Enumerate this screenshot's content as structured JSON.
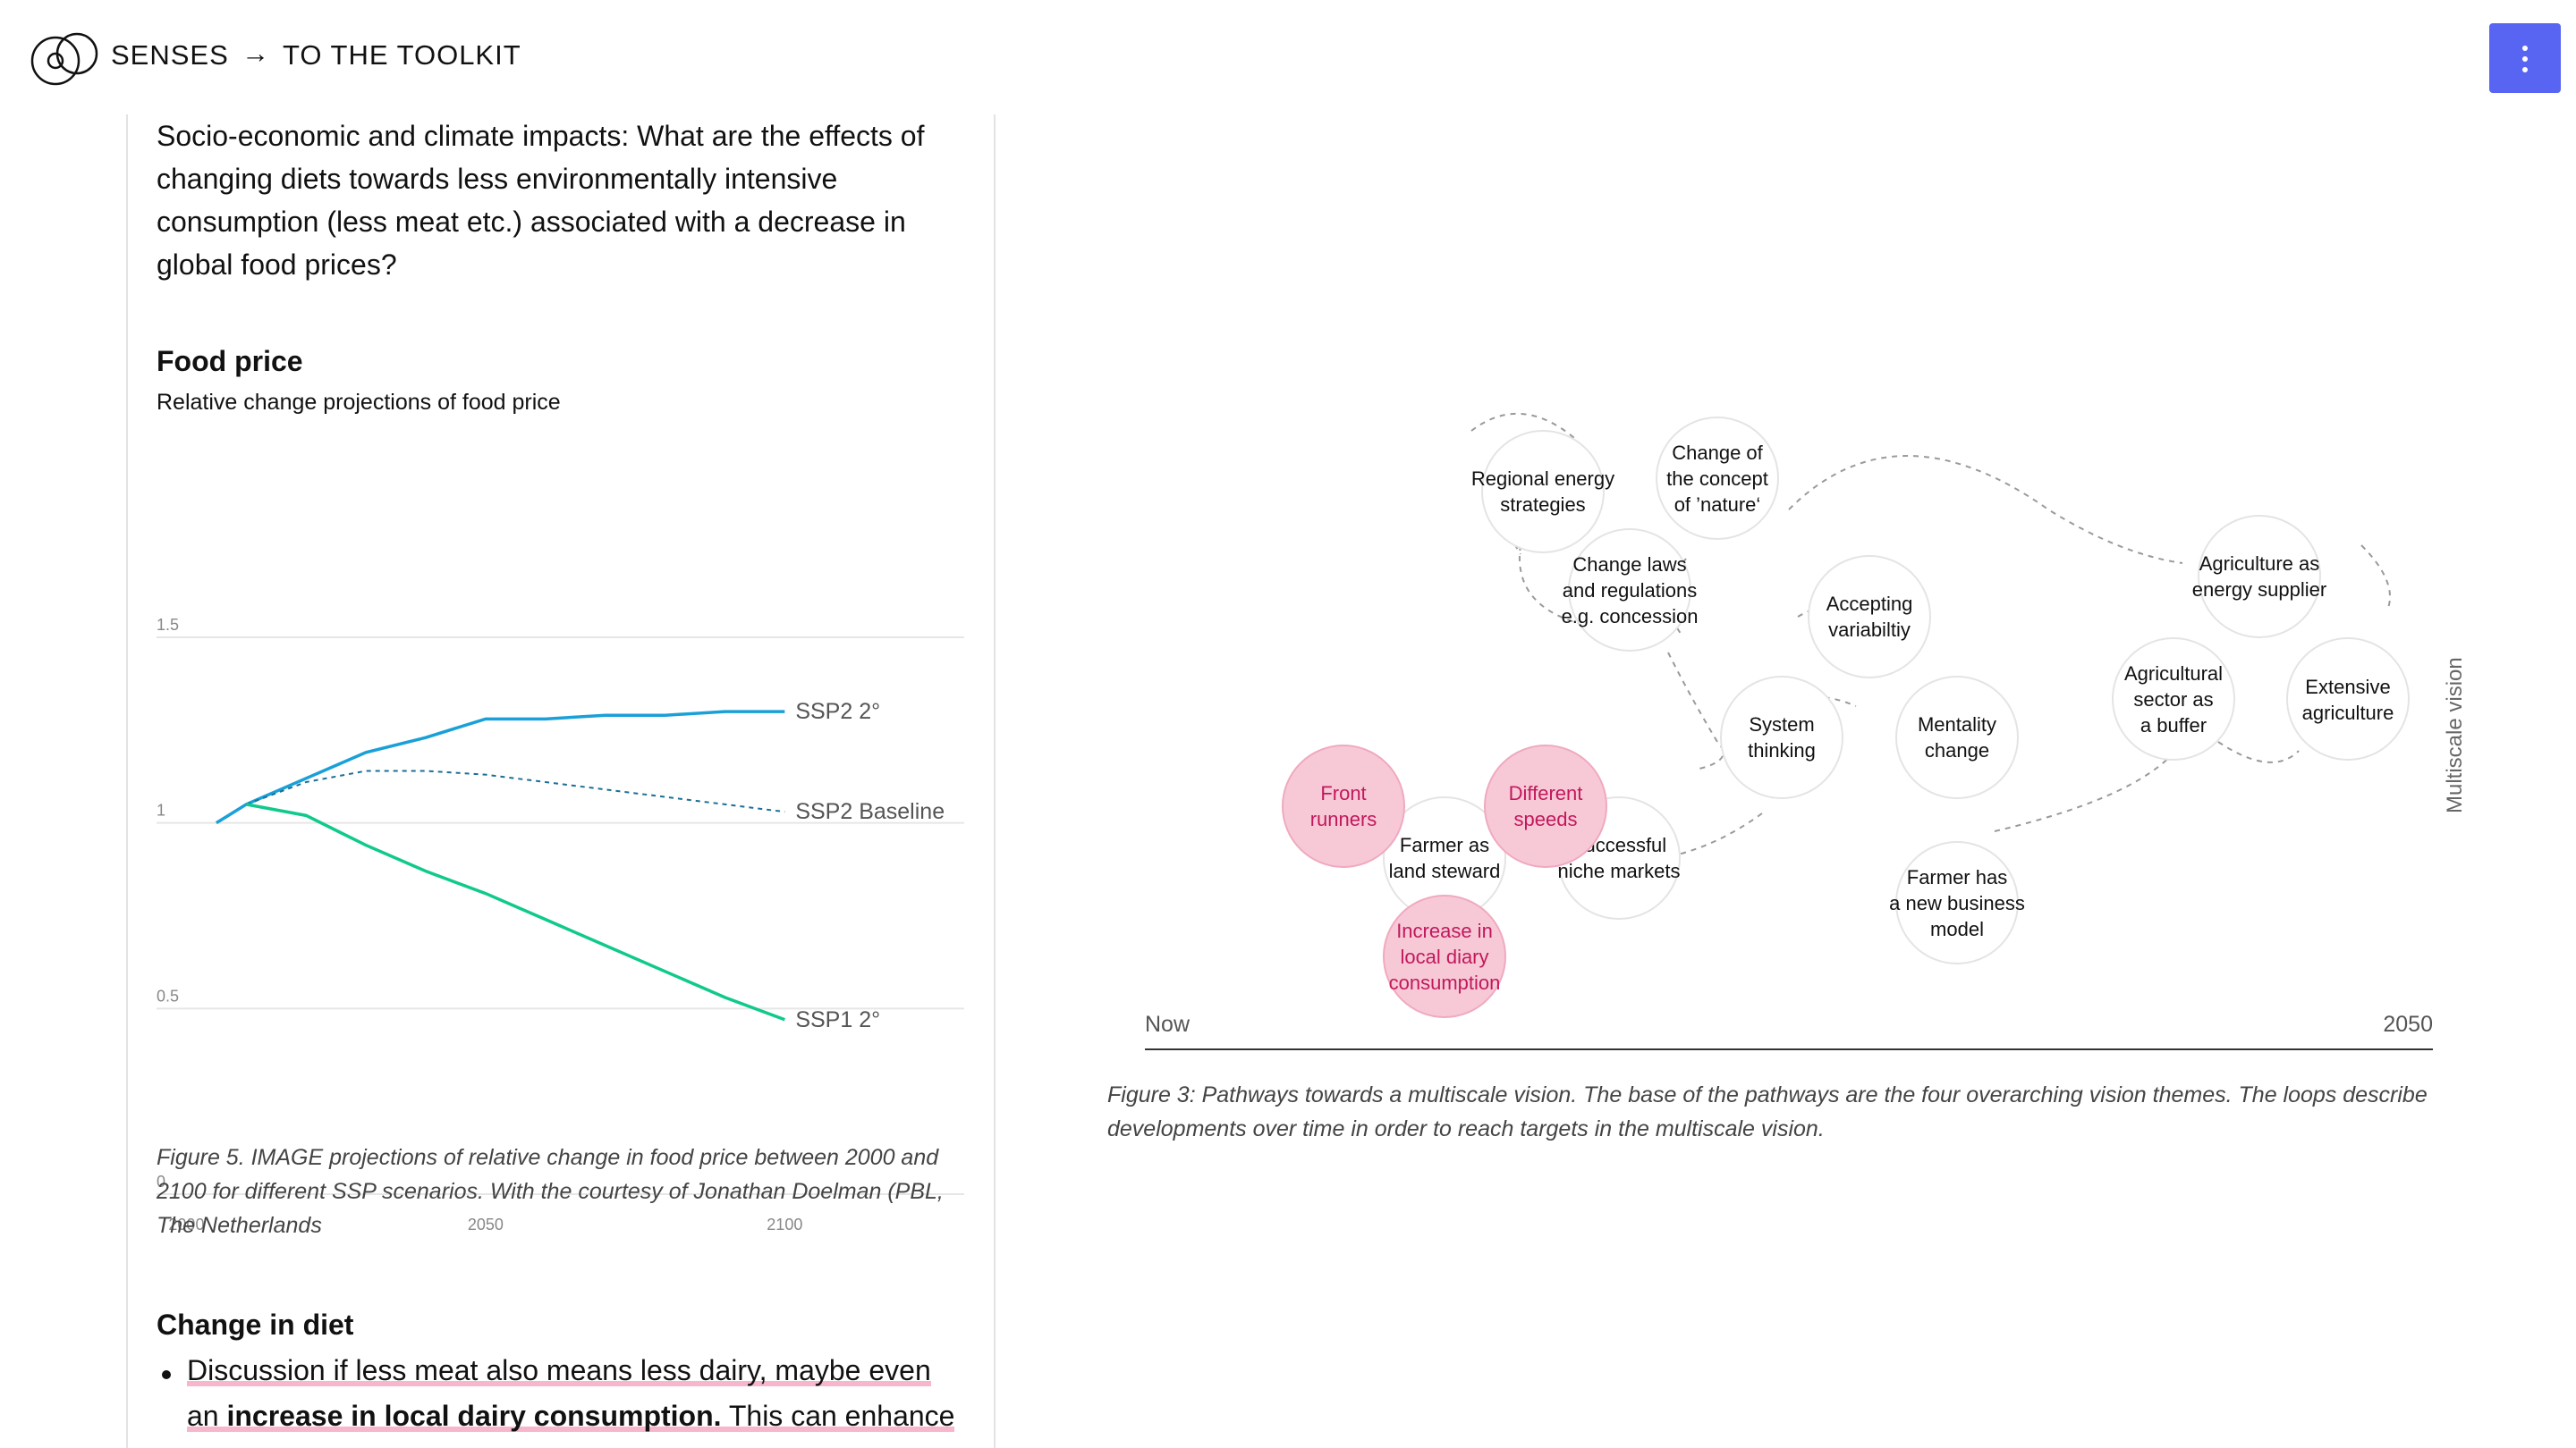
{
  "header": {
    "brand": "SENSES",
    "arrow": "→",
    "crumb": "TO THE TOOLKIT"
  },
  "left": {
    "intro": "Socio-economic and climate impacts: What are the effects of changing diets towards less environmentally intensive consumption (less meat etc.) associated with a decrease in global food prices?",
    "food_title": "Food price",
    "food_subtitle": "Relative change projections of food price",
    "caption": "Figure 5. IMAGE projections of relative change in food price between 2000 and 2100 for different SSP scenarios. With the courtesy of Jonathan Doelman (PBL, The Netherlands",
    "diet_title": "Change in diet",
    "bullet": {
      "part1": "Discussion if less meat also means less dairy, maybe even an ",
      "bold": "increase in local dairy consumption.",
      "part2": " This can enhance"
    }
  },
  "chart_data": {
    "type": "line",
    "title": "Food price",
    "subtitle": "Relative change projections of food price",
    "xlabel": "",
    "ylabel": "",
    "xlim": [
      1995,
      2130
    ],
    "ylim": [
      0,
      1.5
    ],
    "xticks": [
      2000,
      2050,
      2100
    ],
    "yticks": [
      0,
      0.5,
      1,
      1.5
    ],
    "ytick_labels": [
      "0",
      "0.5",
      "1",
      "1.5"
    ],
    "grid": true,
    "series": [
      {
        "name": "SSP2 2°",
        "color": "#1aa0d8",
        "dashed": false,
        "x": [
          2005,
          2010,
          2020,
          2030,
          2040,
          2050,
          2060,
          2070,
          2080,
          2090,
          2100
        ],
        "y": [
          1.0,
          1.05,
          1.12,
          1.19,
          1.23,
          1.28,
          1.28,
          1.29,
          1.29,
          1.3,
          1.3
        ]
      },
      {
        "name": "SSP2 Baseline",
        "color": "#1a6f95",
        "dashed": true,
        "x": [
          2010,
          2020,
          2030,
          2040,
          2050,
          2060,
          2070,
          2080,
          2090,
          2100
        ],
        "y": [
          1.05,
          1.11,
          1.14,
          1.14,
          1.13,
          1.11,
          1.09,
          1.07,
          1.05,
          1.03
        ]
      },
      {
        "name": "SSP1 2°",
        "color": "#10c98c",
        "dashed": false,
        "x": [
          2010,
          2020,
          2030,
          2040,
          2050,
          2060,
          2070,
          2080,
          2090,
          2100
        ],
        "y": [
          1.05,
          1.02,
          0.94,
          0.87,
          0.81,
          0.74,
          0.67,
          0.6,
          0.53,
          0.47
        ]
      }
    ]
  },
  "diagram": {
    "axis_start": "Now",
    "axis_end": "2050",
    "side_label": "Multiscale vision",
    "bubbles": {
      "regional_energy": [
        "Regional energy",
        "strategies"
      ],
      "change_concept": [
        "Change of",
        "the concept",
        "of ’nature‘"
      ],
      "change_laws": [
        "Change laws",
        "and regulations",
        "e.g. concession"
      ],
      "accepting": [
        "Accepting",
        "variabiltiy"
      ],
      "system_thinking": [
        "System",
        "thinking"
      ],
      "mentality": [
        "Mentality",
        "change"
      ],
      "farmer_steward": [
        "Farmer as",
        "land steward"
      ],
      "niche_markets": [
        "Successful",
        "niche markets"
      ],
      "front_runners": [
        "Front",
        "runners"
      ],
      "different_speeds": [
        "Different",
        "speeds"
      ],
      "local_diary": [
        "Increase in",
        "local diary",
        "consumption"
      ],
      "business_model": [
        "Farmer has",
        "a new business",
        "model"
      ],
      "agri_energy": [
        "Agriculture as",
        "energy supplier"
      ],
      "agri_buffer": [
        "Agricultural",
        "sector as",
        "a buffer"
      ],
      "extensive": [
        "Extensive",
        "agriculture"
      ]
    },
    "caption": "Figure 3: Pathways towards a multiscale vision. The base of the pathways are the four overarching vision themes. The loops describe developments over time in order to reach targets in the multiscale vision."
  },
  "colors": {
    "accent_button": "#5865f2",
    "highlight_pink": "#f7b6cb",
    "bubble_pink_fill": "#f7c9d7",
    "bubble_pink_text": "#c2185b"
  },
  "icons": {
    "logo": "overlapping-circles-logo",
    "menu": "vertical-dots-icon"
  }
}
